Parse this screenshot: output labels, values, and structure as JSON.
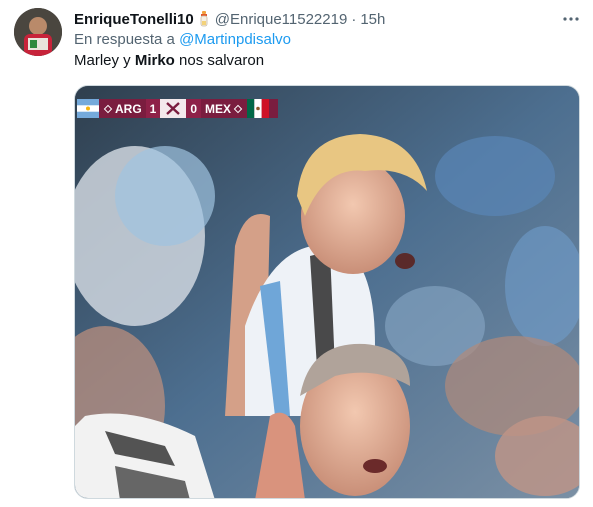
{
  "tweet": {
    "author": {
      "display_name": "EnriqueTonelli10",
      "badge_icon": "baby-bottle-emoji-icon",
      "handle": "@Enrique11522219",
      "separator": "·",
      "time": "15h"
    },
    "reply_to": {
      "prefix": "En respuesta a",
      "mention": "@Martinpdisalvo"
    },
    "text": {
      "part1": "Marley y ",
      "bold": "Mirko",
      "part2": " nos salvaron"
    },
    "more_icon": "more-dots-icon"
  },
  "media": {
    "scorebug": {
      "home_team": "ARG",
      "home_score": "1",
      "away_score": "0",
      "away_team": "MEX"
    }
  },
  "colors": {
    "link": "#1d9bf0",
    "secondary_text": "#536471",
    "scorebug_bg": "#7a1d3f"
  }
}
